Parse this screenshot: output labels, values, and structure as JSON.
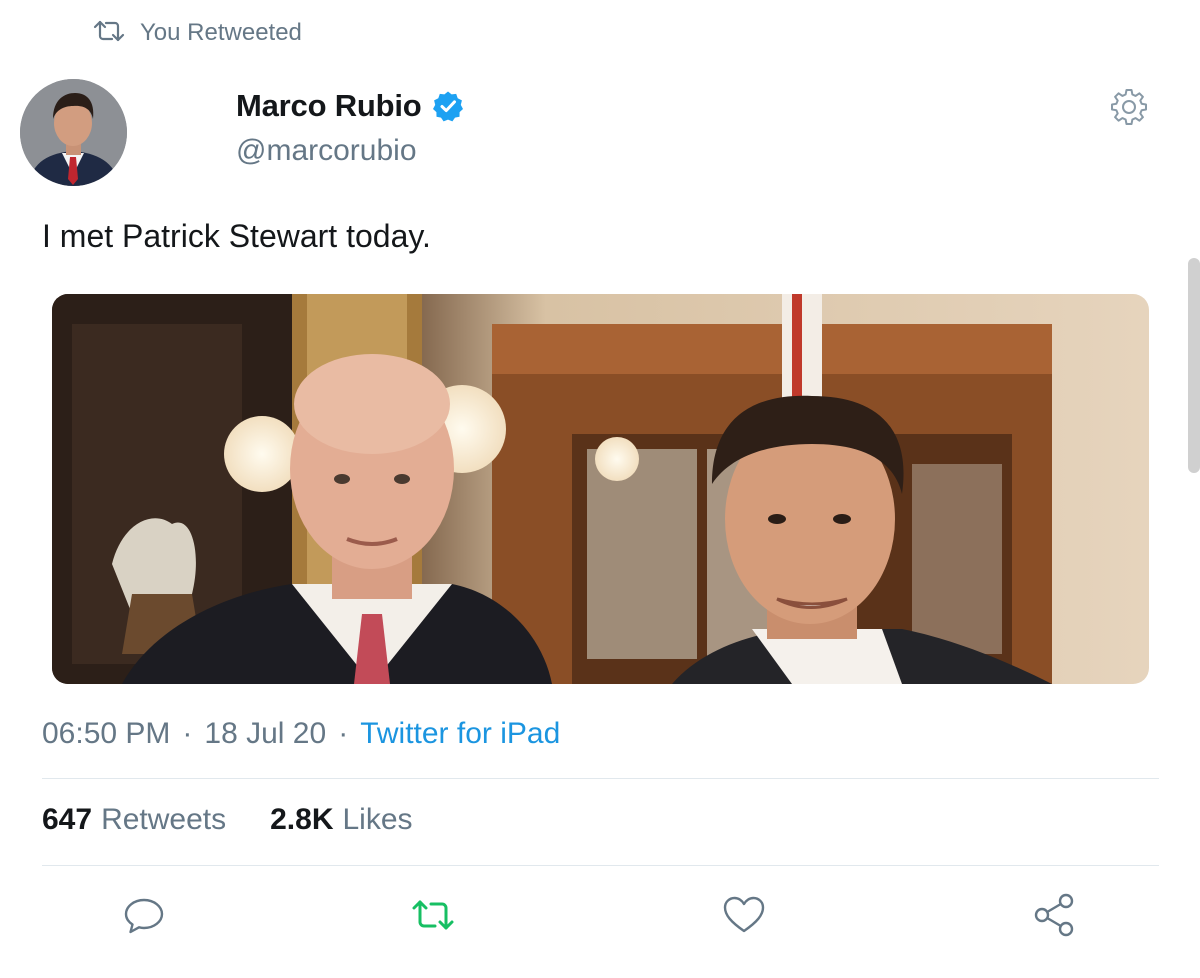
{
  "context": {
    "retweet_label": "You Retweeted",
    "retweet_icon": "retweet-icon"
  },
  "author": {
    "name": "Marco Rubio",
    "handle": "@marcorubio",
    "verified_icon": "verified-badge-icon"
  },
  "tweet": {
    "text": "I met Patrick Stewart today."
  },
  "meta": {
    "time": "06:50 PM",
    "separator": "·",
    "date": "18 Jul 20",
    "source": "Twitter for iPad"
  },
  "stats": {
    "retweets_count": "647",
    "retweets_label": "Retweets",
    "likes_count": "2.8K",
    "likes_label": "Likes"
  },
  "actions": [
    {
      "icon": "reply-icon"
    },
    {
      "icon": "retweet-icon",
      "active": true
    },
    {
      "icon": "like-icon"
    },
    {
      "icon": "share-icon"
    }
  ],
  "colors": {
    "text_primary": "#14171a",
    "text_secondary": "#657786",
    "link": "#1b95e0",
    "verified": "#1da1f2",
    "retweet_active": "#17bf63",
    "divider": "#e1e8ed"
  }
}
